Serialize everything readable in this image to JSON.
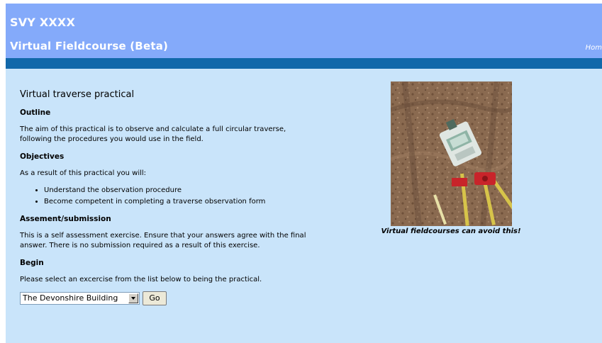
{
  "header": {
    "course_code": "SVY XXXX",
    "site_title": "Virtual Fieldcourse (Beta)",
    "home_link": "Hom"
  },
  "main": {
    "title": "Virtual traverse practical",
    "outline": {
      "heading": "Outline",
      "text": "The aim of this practical is to observe and calculate a full circular traverse, following the procedures you would use in the field."
    },
    "objectives": {
      "heading": "Objectives",
      "intro": "As a result of this practical you will:",
      "items": [
        "Understand the observation procedure",
        "Become competent in completing a traverse observation form"
      ]
    },
    "assessment": {
      "heading": "Assement/submission",
      "text": "This is a self assessment exercise. Ensure that your answers agree with the final answer. There is no submission required as a result of this exercise."
    },
    "begin": {
      "heading": "Begin",
      "text": "Please select an excercise from the list below to being the practical.",
      "select_value": "The Devonshire Building",
      "go_label": "Go"
    }
  },
  "figure": {
    "caption": "Virtual fieldcourses can avoid this!"
  },
  "colors": {
    "header_bg": "#84aafa",
    "bar": "#1168aa",
    "page_bg": "#c9e4fa"
  }
}
